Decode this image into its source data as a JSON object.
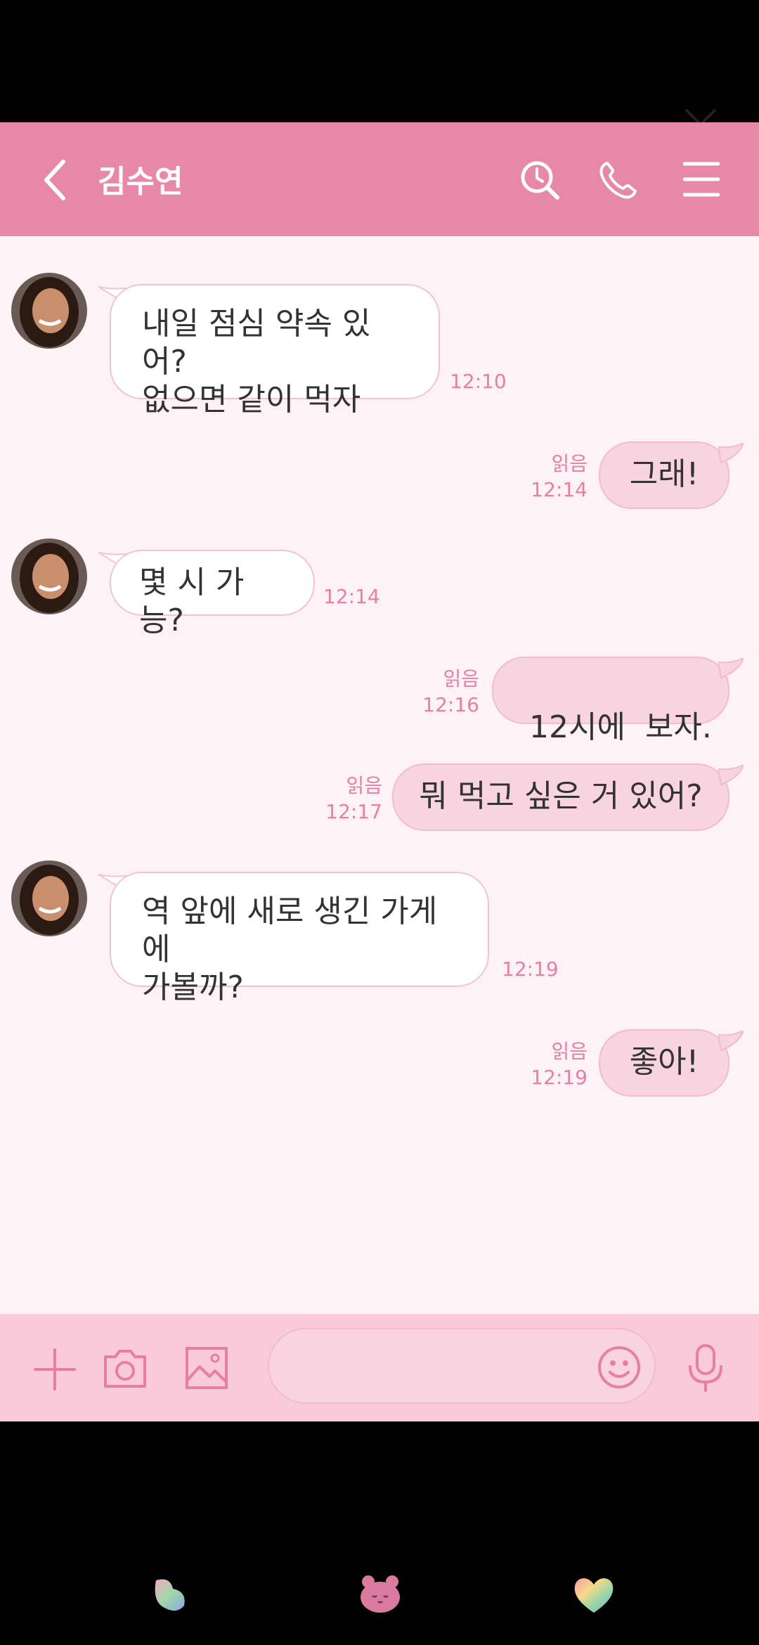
{
  "header": {
    "contact_name": "김수연",
    "icons": [
      "back-icon",
      "search-icon",
      "phone-icon",
      "menu-icon",
      "close-icon"
    ]
  },
  "messages": [
    {
      "side": "in",
      "lines": [
        "내일 점심 약속 있어?",
        "없으면 같이 먹자"
      ],
      "time": "12:10"
    },
    {
      "side": "out",
      "text": "그래!",
      "read": "읽음",
      "time": "12:14"
    },
    {
      "side": "in",
      "lines": [
        "몇 시 가능?"
      ],
      "time": "12:14"
    },
    {
      "side": "out",
      "text": "12시에  보자.",
      "read": "읽음",
      "time": "12:16"
    },
    {
      "side": "out",
      "text": "뭐 먹고 싶은 거 있어?",
      "read": "읽음",
      "time": "12:17"
    },
    {
      "side": "in",
      "lines": [
        "역 앞에 새로 생긴 가게에",
        "가볼까?"
      ],
      "time": "12:19"
    },
    {
      "side": "out",
      "text": "좋아!",
      "read": "읽음",
      "time": "12:19"
    }
  ],
  "input": {
    "placeholder": "",
    "icons": [
      "plus-icon",
      "camera-icon",
      "image-icon",
      "emoji-icon",
      "mic-icon"
    ]
  },
  "colors": {
    "header": "#E888A9",
    "chat_bg": "#FDF2F5",
    "bubble_in": "#FFFFFF",
    "bubble_out": "#F8D3E0",
    "accent": "#E77FA3",
    "input_bar": "#F8CADA"
  }
}
